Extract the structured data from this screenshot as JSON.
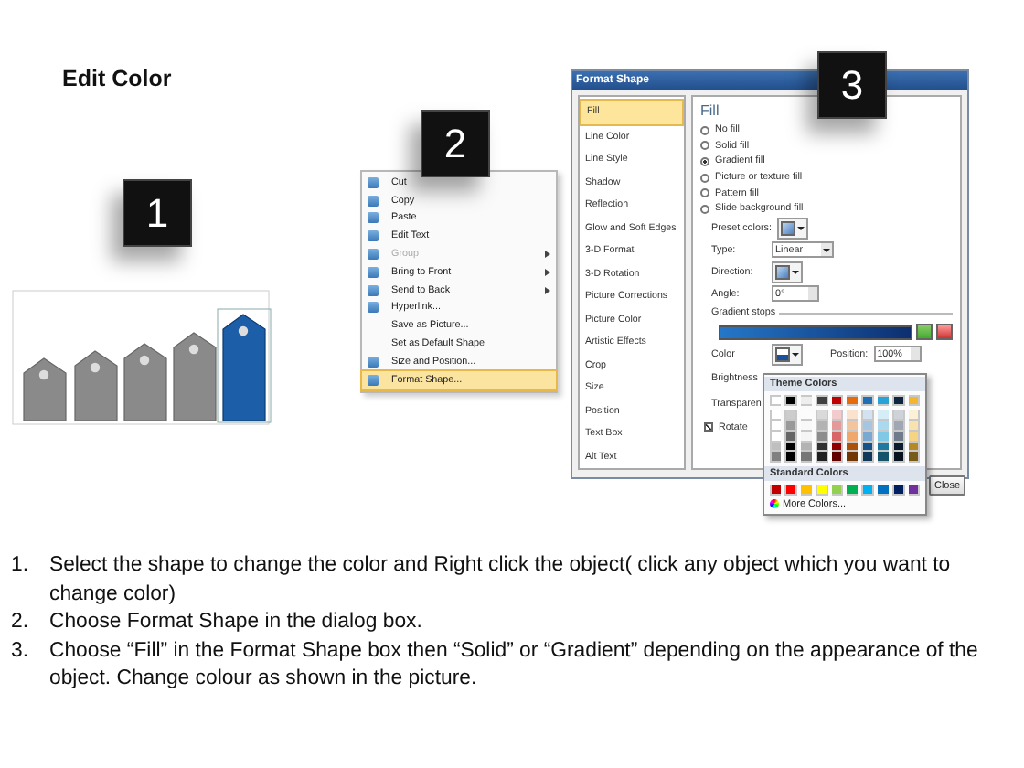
{
  "title": "Edit Color",
  "badges": [
    {
      "number": "1"
    },
    {
      "number": "2"
    },
    {
      "number": "3"
    }
  ],
  "context_menu": {
    "items": [
      {
        "label": "Cut",
        "icon": true,
        "submenu": false,
        "disabled": false,
        "selected": false
      },
      {
        "label": "Copy",
        "icon": true,
        "submenu": false,
        "disabled": false,
        "selected": false
      },
      {
        "label": "Paste",
        "icon": true,
        "submenu": false,
        "disabled": false,
        "selected": false
      },
      {
        "label": "Edit Text",
        "icon": true,
        "submenu": false,
        "disabled": false,
        "selected": false
      },
      {
        "label": "Group",
        "icon": true,
        "submenu": true,
        "disabled": true,
        "selected": false
      },
      {
        "label": "Bring to Front",
        "icon": true,
        "submenu": true,
        "disabled": false,
        "selected": false
      },
      {
        "label": "Send to Back",
        "icon": true,
        "submenu": true,
        "disabled": false,
        "selected": false
      },
      {
        "label": "Hyperlink...",
        "icon": true,
        "submenu": false,
        "disabled": false,
        "selected": false
      },
      {
        "label": "Save as Picture...",
        "icon": false,
        "submenu": false,
        "disabled": false,
        "selected": false
      },
      {
        "label": "Set as Default Shape",
        "icon": false,
        "submenu": false,
        "disabled": false,
        "selected": false
      },
      {
        "label": "Size and Position...",
        "icon": true,
        "submenu": false,
        "disabled": false,
        "selected": false
      },
      {
        "label": "Format Shape...",
        "icon": true,
        "submenu": false,
        "disabled": false,
        "selected": true
      }
    ]
  },
  "dialog": {
    "title": "Format Shape",
    "categories": [
      {
        "label": "Fill",
        "selected": true
      },
      {
        "label": "Line Color",
        "selected": false
      },
      {
        "label": "Line Style",
        "selected": false
      },
      {
        "label": "Shadow",
        "selected": false
      },
      {
        "label": "Reflection",
        "selected": false
      },
      {
        "label": "Glow and Soft Edges",
        "selected": false
      },
      {
        "label": "3-D Format",
        "selected": false
      },
      {
        "label": "3-D Rotation",
        "selected": false
      },
      {
        "label": "Picture Corrections",
        "selected": false
      },
      {
        "label": "Picture Color",
        "selected": false
      },
      {
        "label": "Artistic Effects",
        "selected": false
      },
      {
        "label": "Crop",
        "selected": false
      },
      {
        "label": "Size",
        "selected": false
      },
      {
        "label": "Position",
        "selected": false
      },
      {
        "label": "Text Box",
        "selected": false
      },
      {
        "label": "Alt Text",
        "selected": false
      }
    ],
    "heading": "Fill",
    "fill_options": [
      {
        "label": "No fill",
        "selected": false
      },
      {
        "label": "Solid fill",
        "selected": false
      },
      {
        "label": "Gradient fill",
        "selected": true
      },
      {
        "label": "Picture or texture fill",
        "selected": false
      },
      {
        "label": "Pattern fill",
        "selected": false
      },
      {
        "label": "Slide background fill",
        "selected": false
      }
    ],
    "preset_label": "Preset colors:",
    "type_label": "Type:",
    "type_value": "Linear",
    "direction_label": "Direction:",
    "angle_label": "Angle:",
    "angle_value": "0°",
    "stops_label": "Gradient stops",
    "color_label": "Color",
    "position_label": "Position:",
    "position_value": "100%",
    "brightness_label": "Brightness",
    "transparency_label": "Transparen",
    "rotate": {
      "label": "Rotate",
      "checked": true
    },
    "close_button": "Close"
  },
  "color_popup": {
    "theme_heading": "Theme Colors",
    "theme_colors": [
      {
        "color": "#ffffff"
      },
      {
        "color": "#000000"
      },
      {
        "color": "#eeeeee"
      },
      {
        "color": "#404040"
      },
      {
        "color": "#c00000"
      },
      {
        "color": "#e46c0a"
      },
      {
        "color": "#1f6fb5"
      },
      {
        "color": "#29a3d6"
      },
      {
        "color": "#10253f"
      },
      {
        "color": "#f2b632"
      }
    ],
    "standard_heading": "Standard Colors",
    "standard_colors": [
      {
        "color": "#c00000"
      },
      {
        "color": "#ff0000"
      },
      {
        "color": "#ffc000"
      },
      {
        "color": "#ffff00"
      },
      {
        "color": "#92d050"
      },
      {
        "color": "#00b050"
      },
      {
        "color": "#00b0f0"
      },
      {
        "color": "#0070c0"
      },
      {
        "color": "#002060"
      },
      {
        "color": "#7030a0"
      }
    ],
    "more_colors": "More Colors..."
  },
  "instructions": [
    {
      "number": "1.",
      "text": "Select the shape to change the color and Right click the object( click any object which you want to change color)"
    },
    {
      "number": "2.",
      "text": "Choose Format Shape in the dialog box."
    },
    {
      "number": "3.",
      "text": "Choose “Fill” in the Format Shape box then “Solid” or “Gradient” depending on the appearance of the object. Change colour as shown in the picture."
    }
  ]
}
